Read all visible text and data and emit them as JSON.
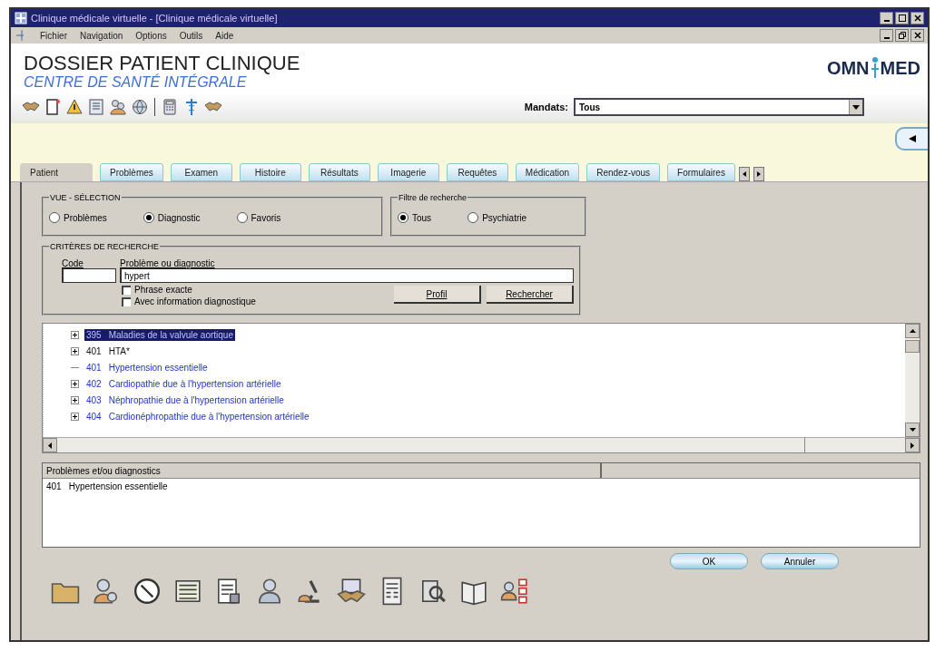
{
  "window": {
    "title": "Clinique médicale virtuelle - [Clinique médicale virtuelle]"
  },
  "menu": [
    "Fichier",
    "Navigation",
    "Options",
    "Outils",
    "Aide"
  ],
  "header": {
    "title": "DOSSIER PATIENT CLINIQUE",
    "subtitle": "CENTRE DE SANTÉ INTÉGRALE",
    "logo_left": "OMN",
    "logo_right": "MED"
  },
  "mandats": {
    "label": "Mandats:",
    "value": "Tous"
  },
  "tabs": [
    {
      "label": "Patient",
      "selected": true
    },
    {
      "label": "Problèmes",
      "selected": false
    },
    {
      "label": "Examen",
      "selected": false
    },
    {
      "label": "Histoire",
      "selected": false
    },
    {
      "label": "Résultats",
      "selected": false
    },
    {
      "label": "Imagerie",
      "selected": false
    },
    {
      "label": "Requêtes",
      "selected": false
    },
    {
      "label": "Médication",
      "selected": false
    },
    {
      "label": "Rendez-vous",
      "selected": false
    },
    {
      "label": "Formulaires",
      "selected": false
    }
  ],
  "view_selection": {
    "title": "VUE - SÉLECTION",
    "options": [
      {
        "label": "Problèmes",
        "selected": false
      },
      {
        "label": "Diagnostic",
        "selected": true
      },
      {
        "label": "Favoris",
        "selected": false
      }
    ]
  },
  "search_filter": {
    "title": "Filtre de recherche",
    "options": [
      {
        "label": "Tous",
        "selected": true
      },
      {
        "label": "Psychiatrie",
        "selected": false
      }
    ]
  },
  "search_criteria": {
    "title": "CRITÈRES DE RECHERCHE",
    "code_label": "Code",
    "term_label": "Problème ou diagnostic",
    "term_value": "hypert",
    "checkboxes": [
      {
        "label": "Phrase exacte",
        "checked": false
      },
      {
        "label": "Avec information diagnostique",
        "checked": false
      }
    ],
    "buttons": [
      "Profil",
      "Rechercher"
    ]
  },
  "tree": [
    {
      "code": "395",
      "label": "Maladies de la valvule aortique",
      "expandable": true,
      "selected": true,
      "kind": "code"
    },
    {
      "code": "401",
      "label": "HTA*",
      "expandable": true,
      "selected": false,
      "kind": "category"
    },
    {
      "code": "401",
      "label": "Hypertension essentielle",
      "expandable": false,
      "selected": false,
      "kind": "code"
    },
    {
      "code": "402",
      "label": "Cardiopathie due à l'hypertension artérielle",
      "expandable": true,
      "selected": false,
      "kind": "code"
    },
    {
      "code": "403",
      "label": "Néphropathie due à l'hypertension artérielle",
      "expandable": true,
      "selected": false,
      "kind": "code"
    },
    {
      "code": "404",
      "label": "Cardionéphropathie due à l'hypertension artérielle",
      "expandable": true,
      "selected": false,
      "kind": "code"
    }
  ],
  "results": {
    "column": "Problèmes et/ou diagnostics",
    "rows": [
      {
        "code": "401",
        "label": "Hypertension essentielle"
      }
    ]
  },
  "buttons": [
    "OK",
    "Annuler"
  ]
}
